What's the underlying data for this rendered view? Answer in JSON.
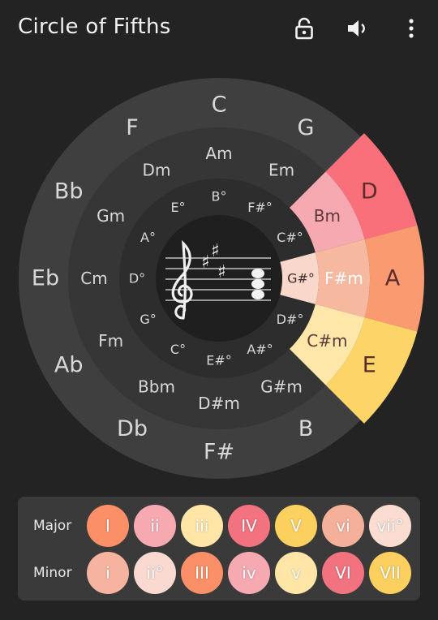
{
  "app": {
    "title": "Circle of Fifths"
  },
  "toolbar": {
    "lock_icon": "lock-icon",
    "sound_icon": "speaker-icon",
    "menu_icon": "more-vert-icon"
  },
  "colors": {
    "outer_ring": "#3f3f3f",
    "middle_ring": "#363636",
    "inner_ring": "#2d2d2d",
    "center": "#1f1f1f",
    "text": "#d8d8d8",
    "tonic": "#fb8f67",
    "super": "#f8a4b0",
    "mediant": "#ffe6a7",
    "sub": "#ef6f7c",
    "dominant": "#fcd05f",
    "subm": "#f5a98a"
  },
  "wheel": {
    "major": [
      "C",
      "G",
      "D",
      "A",
      "E",
      "B",
      "F#",
      "Db",
      "Ab",
      "Eb",
      "Bb",
      "F"
    ],
    "minor": [
      "Am",
      "Em",
      "Bm",
      "F#m",
      "C#m",
      "G#m",
      "D#m",
      "Bbm",
      "Fm",
      "Cm",
      "Gm",
      "Dm"
    ],
    "dim": [
      "B°",
      "F#°",
      "C#°",
      "G#°",
      "D#°",
      "A#°",
      "E#°",
      "C°",
      "G°",
      "D°",
      "A°",
      "E°"
    ],
    "highlight": {
      "major": [
        {
          "index": 2,
          "color": "#f9707b"
        },
        {
          "index": 3,
          "color": "#fa9a70"
        },
        {
          "index": 4,
          "color": "#fdd467"
        }
      ],
      "minor": [
        {
          "index": 2,
          "color": "#f7a9b2"
        },
        {
          "index": 3,
          "color": "#f7b8a0"
        },
        {
          "index": 4,
          "color": "#ffe7a9"
        }
      ],
      "dim": [
        {
          "index": 3,
          "color": "#fad7cb"
        }
      ]
    },
    "key_signature": {
      "clef": "treble-clef",
      "accidentals": "3 sharps"
    }
  },
  "degrees": {
    "major": {
      "label": "Major",
      "chips": [
        {
          "label": "I",
          "color": "#fb8f67"
        },
        {
          "label": "ii",
          "color": "#f7a9b2"
        },
        {
          "label": "iii",
          "color": "#ffe6a7"
        },
        {
          "label": "IV",
          "color": "#f2727f"
        },
        {
          "label": "V",
          "color": "#fcd05f"
        },
        {
          "label": "vi",
          "color": "#f5b09a"
        },
        {
          "label": "vii°",
          "color": "#fbdcd0"
        }
      ]
    },
    "minor": {
      "label": "Minor",
      "chips": [
        {
          "label": "i",
          "color": "#f6b39f"
        },
        {
          "label": "ii°",
          "color": "#fadad0"
        },
        {
          "label": "III",
          "color": "#fb8f67"
        },
        {
          "label": "iv",
          "color": "#f7a9b2"
        },
        {
          "label": "v",
          "color": "#ffe6a7"
        },
        {
          "label": "VI",
          "color": "#f2727f"
        },
        {
          "label": "VII",
          "color": "#fcd05f"
        }
      ]
    }
  }
}
